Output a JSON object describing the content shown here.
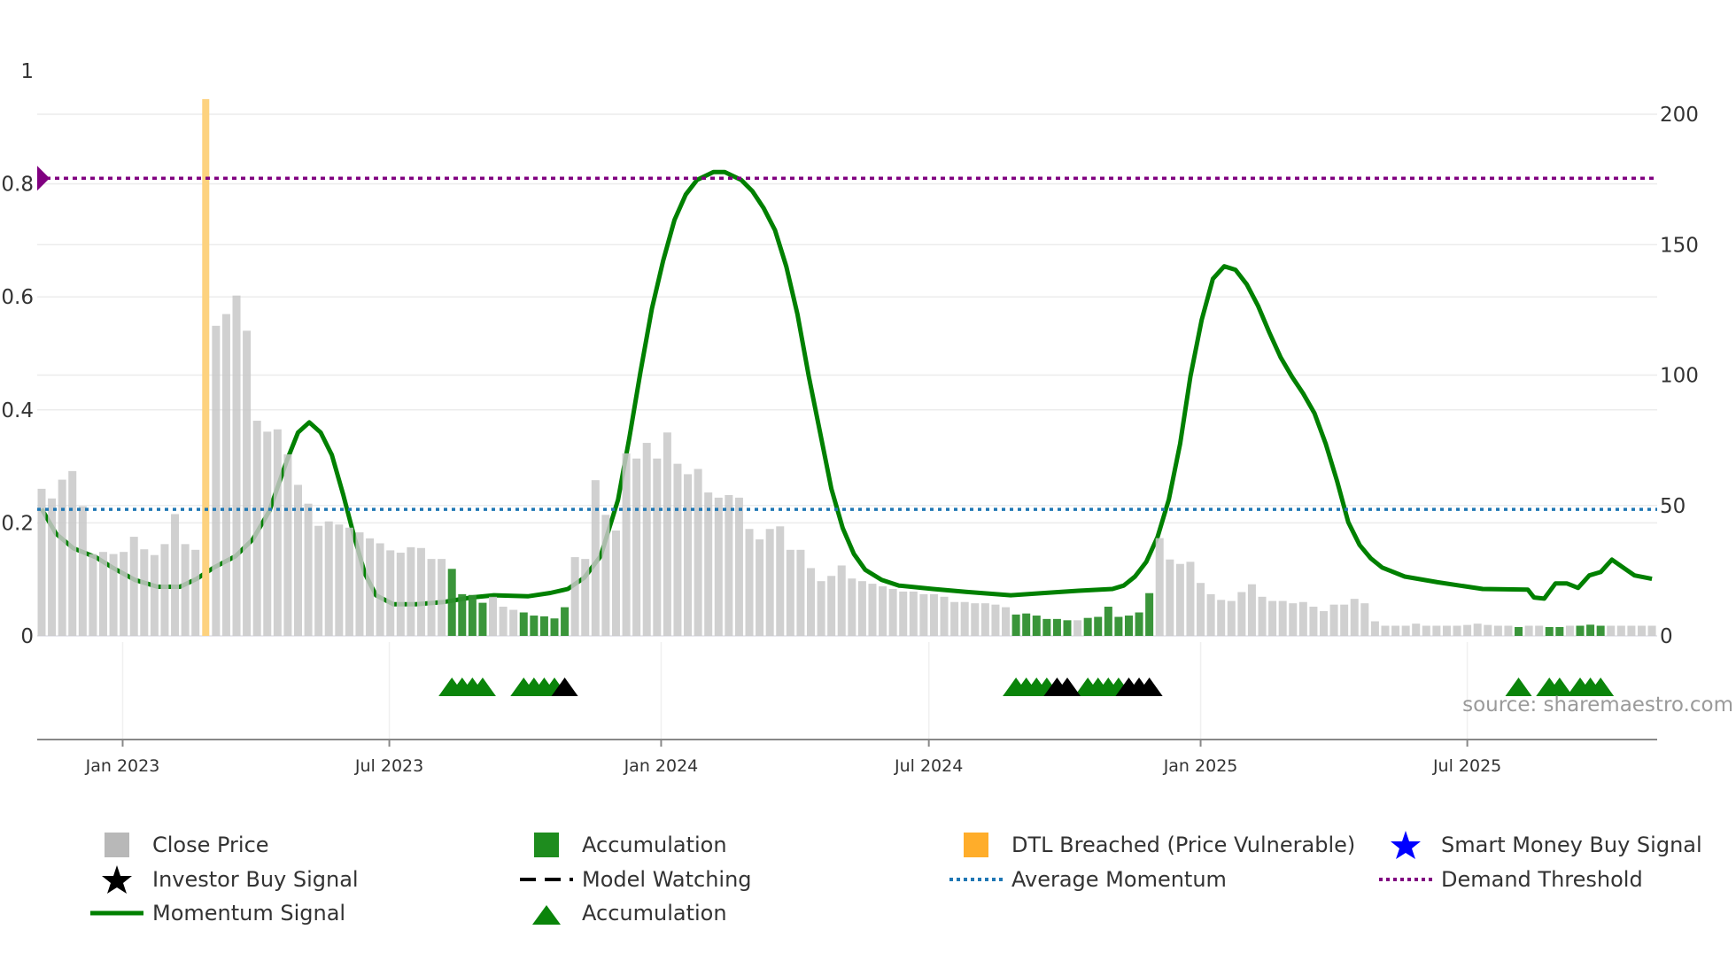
{
  "chart_data": {
    "type": "bar",
    "title": "",
    "x_unit": "week index (weekly bars)",
    "left_axis": {
      "range": [
        0,
        1
      ],
      "ticks": [
        0,
        0.2,
        0.4,
        0.6,
        0.8,
        1
      ],
      "tick_labels": [
        "0",
        "0.2",
        "0.4",
        "0.6",
        "0.8",
        "1"
      ]
    },
    "right_axis": {
      "range": [
        0,
        200
      ],
      "ticks": [
        0,
        50,
        100,
        150,
        200
      ],
      "tick_labels": [
        "0",
        "50",
        "100",
        "150",
        "200"
      ]
    },
    "x_ticks": [
      {
        "week": 7.9,
        "label": "Jan 2023"
      },
      {
        "week": 33.9,
        "label": "Jul 2023"
      },
      {
        "week": 60.4,
        "label": "Jan 2024"
      },
      {
        "week": 86.5,
        "label": "Jul 2024"
      },
      {
        "week": 113,
        "label": "Jan 2025"
      },
      {
        "week": 139,
        "label": "Jul 2025"
      }
    ],
    "close_price": [
      56.4,
      52.7,
      59.9,
      63.2,
      49.7,
      31.4,
      32.2,
      31.4,
      32.2,
      38,
      33.2,
      31,
      35.2,
      46.7,
      35.2,
      33,
      31,
      118.9,
      123.4,
      130.5,
      117,
      82.5,
      78.3,
      79.2,
      69.6,
      57.9,
      50.7,
      42.2,
      43.9,
      42.7,
      41.5,
      39.7,
      37.4,
      35.5,
      32.8,
      31.9,
      34,
      33.7,
      29.5,
      29.5,
      25.7,
      16,
      15.7,
      12.7,
      15,
      11.2,
      10,
      9,
      7.8,
      7.5,
      6.7,
      11,
      30.2,
      29.5,
      59.7,
      46.4,
      40.4,
      70,
      68,
      74,
      68,
      78,
      66,
      62,
      64,
      55,
      53,
      54,
      53,
      41,
      37,
      41,
      42,
      33,
      33,
      26,
      21,
      23,
      27,
      22,
      21,
      20,
      19,
      18,
      17,
      17,
      16,
      16,
      15,
      13,
      13,
      12.5,
      12.5,
      12,
      11,
      8.2,
      8.6,
      7.8,
      6.5,
      6.5,
      6,
      6,
      6.9,
      7.3,
      11.2,
      7.3,
      7.8,
      9,
      16.4,
      37.5,
      29.3,
      27.6,
      28.4,
      20.3,
      16,
      13.8,
      13.4,
      16.8,
      19.8,
      15,
      13.4,
      13.4,
      12.5,
      13,
      11.2,
      9.5,
      12,
      12,
      14.2,
      12.5,
      5.6,
      3.9,
      3.9,
      3.9,
      4.7,
      3.9,
      3.9,
      3.9,
      3.9,
      4.2,
      4.7,
      4.2,
      3.9,
      3.9,
      3.4,
      3.9,
      3.9,
      3.4,
      3.4,
      3.9,
      3.9,
      4.3,
      3.9,
      3.9,
      3.9,
      3.9,
      3.9,
      3.9
    ],
    "accumulation_weeks": [
      40,
      41,
      42,
      43,
      47,
      48,
      49,
      50,
      51,
      95,
      96,
      97,
      98,
      99,
      100,
      102,
      103,
      104,
      105,
      106,
      107,
      108,
      144,
      147,
      148,
      150,
      151,
      152
    ],
    "dtl_breached_week": 16,
    "dtl_breached_level": 0.95,
    "momentum_signal": [
      [
        0,
        0.225
      ],
      [
        1.4,
        0.181
      ],
      [
        3.1,
        0.155
      ],
      [
        5.3,
        0.139
      ],
      [
        6.9,
        0.121
      ],
      [
        9.1,
        0.099
      ],
      [
        11.3,
        0.087
      ],
      [
        13.5,
        0.087
      ],
      [
        15.1,
        0.101
      ],
      [
        16.8,
        0.121
      ],
      [
        18.9,
        0.141
      ],
      [
        20.6,
        0.171
      ],
      [
        22.2,
        0.221
      ],
      [
        23.9,
        0.31
      ],
      [
        25,
        0.36
      ],
      [
        26.1,
        0.378
      ],
      [
        27.2,
        0.36
      ],
      [
        28.3,
        0.32
      ],
      [
        29.4,
        0.25
      ],
      [
        30.4,
        0.181
      ],
      [
        31.5,
        0.111
      ],
      [
        32.6,
        0.072
      ],
      [
        34.3,
        0.056
      ],
      [
        36.5,
        0.056
      ],
      [
        39.2,
        0.06
      ],
      [
        41.9,
        0.068
      ],
      [
        44.1,
        0.072
      ],
      [
        47.4,
        0.07
      ],
      [
        49.6,
        0.076
      ],
      [
        51.3,
        0.083
      ],
      [
        52.9,
        0.103
      ],
      [
        54.5,
        0.141
      ],
      [
        56.2,
        0.241
      ],
      [
        57.3,
        0.35
      ],
      [
        58.4,
        0.469
      ],
      [
        59.5,
        0.579
      ],
      [
        60.6,
        0.664
      ],
      [
        61.7,
        0.736
      ],
      [
        62.8,
        0.781
      ],
      [
        63.9,
        0.807
      ],
      [
        65.5,
        0.821
      ],
      [
        66.6,
        0.821
      ],
      [
        68.2,
        0.807
      ],
      [
        69.3,
        0.787
      ],
      [
        70.4,
        0.757
      ],
      [
        71.5,
        0.718
      ],
      [
        72.6,
        0.654
      ],
      [
        73.7,
        0.569
      ],
      [
        74.8,
        0.459
      ],
      [
        75.9,
        0.36
      ],
      [
        77,
        0.26
      ],
      [
        78.1,
        0.191
      ],
      [
        79.2,
        0.145
      ],
      [
        80.3,
        0.117
      ],
      [
        81.9,
        0.099
      ],
      [
        83.6,
        0.089
      ],
      [
        86.9,
        0.083
      ],
      [
        90.1,
        0.078
      ],
      [
        94.5,
        0.072
      ],
      [
        97.8,
        0.076
      ],
      [
        101.1,
        0.08
      ],
      [
        104.4,
        0.083
      ],
      [
        105.5,
        0.089
      ],
      [
        106.6,
        0.105
      ],
      [
        107.7,
        0.131
      ],
      [
        108.8,
        0.175
      ],
      [
        109.9,
        0.241
      ],
      [
        111,
        0.34
      ],
      [
        112,
        0.459
      ],
      [
        113.1,
        0.559
      ],
      [
        114.2,
        0.632
      ],
      [
        115.3,
        0.654
      ],
      [
        116.4,
        0.648
      ],
      [
        117.5,
        0.622
      ],
      [
        118.6,
        0.584
      ],
      [
        119.7,
        0.537
      ],
      [
        120.8,
        0.493
      ],
      [
        121.9,
        0.459
      ],
      [
        123,
        0.429
      ],
      [
        124.1,
        0.394
      ],
      [
        125.2,
        0.34
      ],
      [
        126.3,
        0.274
      ],
      [
        127.4,
        0.201
      ],
      [
        128.5,
        0.161
      ],
      [
        129.6,
        0.137
      ],
      [
        130.7,
        0.121
      ],
      [
        132.9,
        0.105
      ],
      [
        136.1,
        0.095
      ],
      [
        140.5,
        0.083
      ],
      [
        144.9,
        0.082
      ],
      [
        145.5,
        0.068
      ],
      [
        146.5,
        0.066
      ],
      [
        147.6,
        0.093
      ],
      [
        148.7,
        0.093
      ],
      [
        149.8,
        0.085
      ],
      [
        150.9,
        0.107
      ],
      [
        152,
        0.113
      ],
      [
        153.1,
        0.135
      ],
      [
        154.2,
        0.121
      ],
      [
        155.3,
        0.107
      ],
      [
        157,
        0.101
      ]
    ],
    "average_momentum": 0.224,
    "demand_threshold": 0.81,
    "accumulation_markers_green": [
      40,
      41,
      42,
      43,
      47,
      48,
      49,
      50,
      95,
      96,
      97,
      98,
      102,
      103,
      104,
      105,
      144,
      147,
      148,
      150,
      151,
      152
    ],
    "investor_markers_black": [
      51,
      99,
      100,
      106,
      107,
      108
    ],
    "source": "source: sharemaestro.com",
    "legend": [
      {
        "label": "Close Price",
        "icon": "gray-square"
      },
      {
        "label": "Accumulation",
        "icon": "green-square"
      },
      {
        "label": "DTL Breached (Price Vulnerable)",
        "icon": "orange-square"
      },
      {
        "label": "Smart Money Buy Signal",
        "icon": "blue-star"
      },
      {
        "label": "Investor Buy Signal",
        "icon": "black-star"
      },
      {
        "label": "Model Watching",
        "icon": "black-dash"
      },
      {
        "label": "Average Momentum",
        "icon": "blue-dotted"
      },
      {
        "label": "Demand Threshold",
        "icon": "purple-dotted"
      },
      {
        "label": "Momentum Signal",
        "icon": "green-line"
      },
      {
        "label": "Accumulation",
        "icon": "green-triangle"
      }
    ],
    "legend_position": "bottom",
    "colors": {
      "close": "#c8c8c8",
      "accum": "#2f8f2f",
      "dtl": "#fdd27f",
      "momentum": "#008000",
      "avg": "#1f77b4",
      "demand": "#800080",
      "black": "#000000",
      "blue_star": "#0000ff"
    }
  }
}
